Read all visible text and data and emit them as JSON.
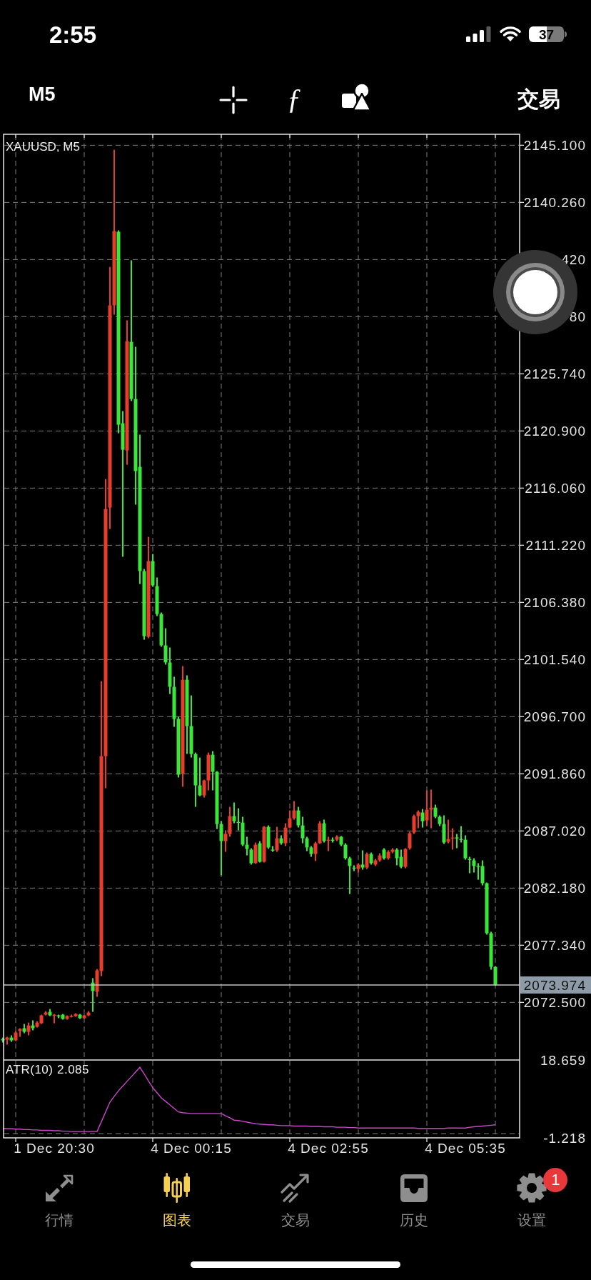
{
  "status_bar": {
    "time": "2:55",
    "battery": "37"
  },
  "toolbar": {
    "timeframe": "M5",
    "indicator_button": "ƒ",
    "trade_button": "交易"
  },
  "chart": {
    "price_chart": {
      "covered_tick_labels": [
        "420",
        "80"
      ],
      "chart_data": {
        "type": "candlestick",
        "title": "XAUUSD, M5",
        "grid": true,
        "categories": [
          null,
          null,
          null,
          null,
          null,
          null,
          null,
          null,
          null,
          null,
          null,
          null,
          "1 Dec 20:30",
          null,
          null,
          null,
          null,
          null,
          null,
          null,
          null,
          null,
          null,
          null,
          null,
          null,
          null,
          null,
          null,
          null,
          null,
          null,
          null,
          null,
          null,
          null,
          null,
          null,
          null,
          null,
          null,
          null,
          null,
          null,
          "4 Dec 00:15",
          null,
          null,
          null,
          null,
          null,
          null,
          null,
          null,
          null,
          null,
          null,
          null,
          null,
          null,
          null,
          null,
          null,
          null,
          null,
          null,
          null,
          null,
          null,
          null,
          null,
          null,
          null,
          null,
          null,
          null,
          null,
          "4 Dec 02:55",
          null,
          null,
          null,
          null,
          null,
          null,
          null,
          null,
          null,
          null,
          null,
          null,
          null,
          null,
          null,
          null,
          null,
          null,
          null,
          null,
          null,
          null,
          null,
          null,
          null,
          null,
          null,
          null,
          null,
          null,
          null,
          "4 Dec 05:35",
          null,
          null,
          null,
          null,
          null,
          null,
          null
        ],
        "ohlc": [
          [
            2069.4,
            2069.52,
            2069.1,
            2069.28
          ],
          [
            2069.34,
            2069.58,
            2068.92,
            2069.52
          ],
          [
            2069.52,
            2069.71,
            2069.16,
            2069.28
          ],
          [
            2069.28,
            2070.07,
            2069.22,
            2069.95
          ],
          [
            2070.07,
            2070.31,
            2069.58,
            2070.25
          ],
          [
            2070.31,
            2070.67,
            2069.89,
            2070.01
          ],
          [
            2070.01,
            2070.79,
            2069.71,
            2070.55
          ],
          [
            2070.55,
            2070.98,
            2070.13,
            2070.31
          ],
          [
            2070.43,
            2070.91,
            2070.37,
            2070.79
          ],
          [
            2070.73,
            2071.46,
            2070.67,
            2071.4
          ],
          [
            2071.46,
            2071.76,
            2071.4,
            2071.64
          ],
          [
            2071.7,
            2071.94,
            2071.34,
            2071.4
          ],
          [
            2071.4,
            2071.52,
            2070.73,
            2071.46
          ],
          [
            2071.4,
            2071.46,
            2071.16,
            2071.34
          ],
          [
            2071.46,
            2071.52,
            2071.04,
            2071.1
          ],
          [
            2071.1,
            2071.4,
            2071.04,
            2071.34
          ],
          [
            2071.28,
            2071.46,
            2071.22,
            2071.34
          ],
          [
            2071.34,
            2071.58,
            2071.28,
            2071.52
          ],
          [
            2071.46,
            2071.52,
            2071.1,
            2071.16
          ],
          [
            2071.16,
            2071.46,
            2071.1,
            2071.4
          ],
          [
            2071.4,
            2071.76,
            2071.34,
            2071.64
          ],
          [
            2074.18,
            2074.55,
            2071.7,
            2073.46
          ],
          [
            2073.4,
            2075.33,
            2072.97,
            2075.21
          ],
          [
            2075.15,
            2099.71,
            2074.73,
            2093.36
          ],
          [
            2093.36,
            2116.83,
            2090.64,
            2114.29
          ],
          [
            2114.41,
            2134.8,
            2112.6,
            2131.54
          ],
          [
            2131.54,
            2144.72,
            2130.75,
            2137.83
          ],
          [
            2137.77,
            2137.89,
            2120.71,
            2121.43
          ],
          [
            2121.55,
            2122.58,
            2110.24,
            2119.31
          ],
          [
            2119.25,
            2130.27,
            2118.04,
            2128.51
          ],
          [
            2128.45,
            2135.35,
            2123.43,
            2123.61
          ],
          [
            2123.61,
            2128.03,
            2114.66,
            2117.5
          ],
          [
            2117.86,
            2120.59,
            2107.94,
            2109.03
          ],
          [
            2109.03,
            2109.21,
            2103.22,
            2103.52
          ],
          [
            2103.46,
            2111.93,
            2103.34,
            2109.88
          ],
          [
            2109.88,
            2110.48,
            2107.7,
            2107.82
          ],
          [
            2107.76,
            2108.49,
            2105.22,
            2105.4
          ],
          [
            2105.4,
            2105.52,
            2102.62,
            2102.74
          ],
          [
            2102.74,
            2104.19,
            2101.11,
            2101.29
          ],
          [
            2101.29,
            2102.56,
            2098.62,
            2099.23
          ],
          [
            2099.23,
            2100.08,
            2095.84,
            2096.51
          ],
          [
            2096.51,
            2096.69,
            2091.55,
            2091.79
          ],
          [
            2091.85,
            2100.98,
            2090.76,
            2099.83
          ],
          [
            2099.83,
            2100.2,
            2093.54,
            2095.9
          ],
          [
            2095.9,
            2098.5,
            2093.24,
            2093.54
          ],
          [
            2093.54,
            2093.66,
            2089.06,
            2090.88
          ],
          [
            2090.88,
            2093.24,
            2089.97,
            2090.03
          ],
          [
            2090.03,
            2091.36,
            2089.85,
            2091.3
          ],
          [
            2091.3,
            2093.66,
            2090.46,
            2093.48
          ],
          [
            2093.48,
            2093.78,
            2090.46,
            2092.03
          ],
          [
            2092.03,
            2092.09,
            2087.19,
            2087.61
          ],
          [
            2087.61,
            2087.85,
            2083.26,
            2086.16
          ],
          [
            2086.16,
            2087.07,
            2085.25,
            2086.77
          ],
          [
            2086.77,
            2089.06,
            2086.53,
            2088.28
          ],
          [
            2088.28,
            2089.43,
            2087.67,
            2087.85
          ],
          [
            2087.79,
            2088.94,
            2087.07,
            2087.73
          ],
          [
            2087.73,
            2088.22,
            2085.74,
            2085.86
          ],
          [
            2085.86,
            2086.53,
            2084.95,
            2085.5
          ],
          [
            2085.44,
            2085.56,
            2084.17,
            2084.29
          ],
          [
            2084.29,
            2086.04,
            2084.23,
            2085.86
          ],
          [
            2085.98,
            2086.16,
            2084.35,
            2084.41
          ],
          [
            2084.41,
            2087.43,
            2084.35,
            2087.37
          ],
          [
            2087.37,
            2087.49,
            2085.5,
            2085.62
          ],
          [
            2085.44,
            2085.74,
            2085.25,
            2085.38
          ],
          [
            2085.38,
            2087.37,
            2085.25,
            2086.4
          ],
          [
            2086.4,
            2086.65,
            2085.86,
            2085.98
          ],
          [
            2085.98,
            2087.67,
            2085.74,
            2087.31
          ],
          [
            2087.31,
            2088.76,
            2087.25,
            2088.1
          ],
          [
            2088.1,
            2089.55,
            2087.98,
            2088.76
          ],
          [
            2088.76,
            2089.06,
            2087.31,
            2087.49
          ],
          [
            2087.49,
            2088.22,
            2085.98,
            2086.4
          ],
          [
            2086.4,
            2086.53,
            2085.31,
            2085.62
          ],
          [
            2085.62,
            2085.74,
            2084.83,
            2085.07
          ],
          [
            2085.07,
            2086.1,
            2084.47,
            2085.98
          ],
          [
            2085.98,
            2087.85,
            2085.92,
            2087.67
          ],
          [
            2087.67,
            2087.98,
            2086.04,
            2086.16
          ],
          [
            2086.22,
            2086.53,
            2085.31,
            2086.28
          ],
          [
            2086.28,
            2086.47,
            2086.04,
            2086.22
          ],
          [
            2086.28,
            2086.65,
            2086.16,
            2086.53
          ],
          [
            2086.53,
            2086.59,
            2085.74,
            2085.86
          ],
          [
            2085.86,
            2085.98,
            2084.59,
            2084.71
          ],
          [
            2084.71,
            2084.83,
            2081.68,
            2084.05
          ],
          [
            2083.92,
            2084.11,
            2083.62,
            2083.86
          ],
          [
            2083.8,
            2084.29,
            2083.5,
            2084.17
          ],
          [
            2084.17,
            2085.38,
            2083.74,
            2083.92
          ],
          [
            2083.92,
            2085.19,
            2083.8,
            2085.07
          ],
          [
            2085.07,
            2085.19,
            2084.17,
            2084.29
          ],
          [
            2084.17,
            2084.65,
            2084.05,
            2084.53
          ],
          [
            2084.53,
            2085.13,
            2084.41,
            2084.95
          ],
          [
            2085.44,
            2085.56,
            2084.59,
            2084.71
          ],
          [
            2084.71,
            2085.38,
            2084.59,
            2085.25
          ],
          [
            2085.25,
            2085.56,
            2085.13,
            2085.44
          ],
          [
            2085.44,
            2085.56,
            2084.11,
            2084.71
          ],
          [
            2084.83,
            2085.44,
            2083.86,
            2083.98
          ],
          [
            2083.98,
            2085.56,
            2083.86,
            2085.5
          ],
          [
            2085.56,
            2086.95,
            2085.44,
            2086.83
          ],
          [
            2086.89,
            2088.4,
            2086.77,
            2088.28
          ],
          [
            2088.28,
            2088.76,
            2087.25,
            2088.64
          ],
          [
            2088.58,
            2088.88,
            2087.31,
            2087.85
          ],
          [
            2087.91,
            2090.46,
            2087.43,
            2088.82
          ],
          [
            2088.82,
            2090.52,
            2087.25,
            2089.0
          ],
          [
            2089.0,
            2089.25,
            2088.1,
            2088.22
          ],
          [
            2088.22,
            2088.34,
            2087.43,
            2087.61
          ],
          [
            2087.61,
            2088.34,
            2085.92,
            2086.04
          ],
          [
            2086.1,
            2087.98,
            2085.98,
            2086.34
          ],
          [
            2086.4,
            2087.25,
            2085.44,
            2086.47
          ],
          [
            2086.47,
            2086.77,
            2085.56,
            2086.4
          ],
          [
            2086.34,
            2087.43,
            2086.04,
            2086.28
          ],
          [
            2086.28,
            2086.65,
            2084.59,
            2084.71
          ],
          [
            2084.65,
            2084.83,
            2083.44,
            2084.59
          ],
          [
            2084.53,
            2084.71,
            2083.5,
            2084.05
          ],
          [
            2084.05,
            2084.29,
            2082.89,
            2083.98
          ],
          [
            2084.05,
            2084.53,
            2082.41,
            2082.59
          ],
          [
            2082.59,
            2082.65,
            2078.24,
            2078.36
          ],
          [
            2078.36,
            2078.48,
            2075.27,
            2075.51
          ],
          [
            2075.51,
            2075.57,
            2073.92,
            2073.97
          ]
        ],
        "ylim": [
          2067.62,
          2146.03
        ],
        "yticks": [
          {
            "value": 2145.1,
            "label": "2145.100"
          },
          {
            "value": 2140.26,
            "label": "2140.260"
          },
          {
            "value": 2125.74,
            "label": "2125.740"
          },
          {
            "value": 2120.9,
            "label": "2120.900"
          },
          {
            "value": 2116.06,
            "label": "2116.060"
          },
          {
            "value": 2111.22,
            "label": "2111.220"
          },
          {
            "value": 2106.38,
            "label": "2106.380"
          },
          {
            "value": 2101.54,
            "label": "2101.540"
          },
          {
            "value": 2096.7,
            "label": "2096.700"
          },
          {
            "value": 2091.86,
            "label": "2091.860"
          },
          {
            "value": 2087.02,
            "label": "2087.020"
          },
          {
            "value": 2082.18,
            "label": "2082.180"
          },
          {
            "value": 2077.34,
            "label": "2077.340"
          },
          {
            "value": 2072.5,
            "label": "2072.500"
          }
        ],
        "ref_lines": [
          {
            "axis": "y",
            "value": 2073.974,
            "label": "2073.974"
          }
        ]
      }
    },
    "indicator": {
      "current_value": "2.085",
      "chart_data": {
        "type": "line",
        "grid": true,
        "series": [
          {
            "name": "ATR(10)",
            "color": "#cc48cc",
            "values": [
              1.2,
              1.1,
              1.1,
              1.0,
              1.0,
              0.9,
              0.9,
              0.8,
              0.8,
              0.7,
              0.7,
              0.7,
              0.6,
              0.6,
              0.5,
              0.5,
              0.4,
              0.4,
              0.4,
              0.4,
              0.4,
              0.4,
              0.4,
              2.9,
              5.4,
              7.9,
              9.4,
              10.8,
              12.0,
              13.2,
              14.4,
              15.6,
              16.8,
              15.1,
              13.3,
              11.6,
              10.3,
              9.0,
              8.1,
              7.2,
              6.3,
              5.4,
              5.2,
              5.1,
              5.0,
              5.0,
              5.0,
              5.0,
              5.0,
              5.0,
              5.0,
              5.0,
              4.4,
              3.9,
              3.3,
              3.2,
              3.0,
              2.8,
              2.6,
              2.4,
              2.3,
              2.2,
              2.1,
              2.1,
              2.0,
              1.9,
              1.9,
              1.9,
              1.8,
              1.8,
              1.8,
              1.8,
              1.7,
              1.7,
              1.7,
              1.6,
              1.6,
              1.6,
              1.5,
              1.5,
              1.5,
              1.4,
              1.4,
              1.3,
              1.3,
              1.3,
              1.3,
              1.3,
              1.3,
              1.3,
              1.3,
              1.3,
              1.3,
              1.3,
              1.3,
              1.3,
              1.3,
              1.2,
              1.2,
              1.2,
              1.2,
              1.2,
              1.2,
              1.2,
              1.3,
              1.3,
              1.3,
              1.3,
              1.3,
              1.5,
              1.6,
              1.7,
              1.8,
              1.9,
              2.0,
              2.1
            ]
          }
        ],
        "ylim": [
          -1.218,
          18.659
        ],
        "yticks": [
          18.659,
          -1.218
        ]
      }
    }
  },
  "tabs": [
    {
      "label": "行情",
      "selected": false
    },
    {
      "label": "图表",
      "selected": true
    },
    {
      "label": "交易",
      "selected": false
    },
    {
      "label": "历史",
      "selected": false
    },
    {
      "label": "设置",
      "selected": false,
      "badge": "1"
    }
  ]
}
